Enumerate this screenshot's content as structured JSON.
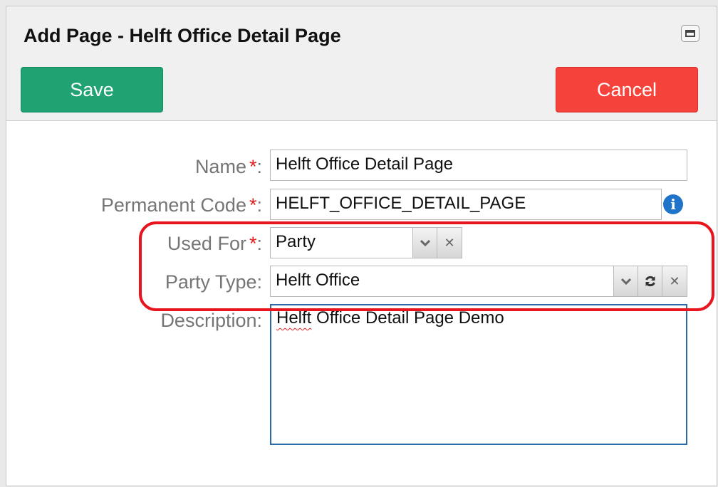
{
  "dialog": {
    "title": "Add Page - Helft Office Detail Page",
    "save_label": "Save",
    "cancel_label": "Cancel"
  },
  "form": {
    "name": {
      "label": "Name",
      "value": "Helft Office Detail Page",
      "required": "*"
    },
    "permanent_code": {
      "label": "Permanent Code",
      "value": "HELFT_OFFICE_DETAIL_PAGE",
      "required": "*"
    },
    "used_for": {
      "label": "Used For",
      "value": "Party",
      "required": "*"
    },
    "party_type": {
      "label": "Party Type:",
      "value": "Helft Office"
    },
    "description": {
      "label": "Description:",
      "value_first_word": "Helft",
      "value_rest": " Office Detail Page Demo"
    }
  },
  "icons": {
    "info": "info-icon",
    "dropdown": "chevron-down-icon",
    "clear": "close-icon",
    "refresh": "refresh-icon",
    "maximize": "maximize-icon"
  },
  "colors": {
    "save": "#20a273",
    "cancel": "#f5423a",
    "required": "#e02020",
    "info": "#1f73c9",
    "highlight": "#e8141e"
  }
}
